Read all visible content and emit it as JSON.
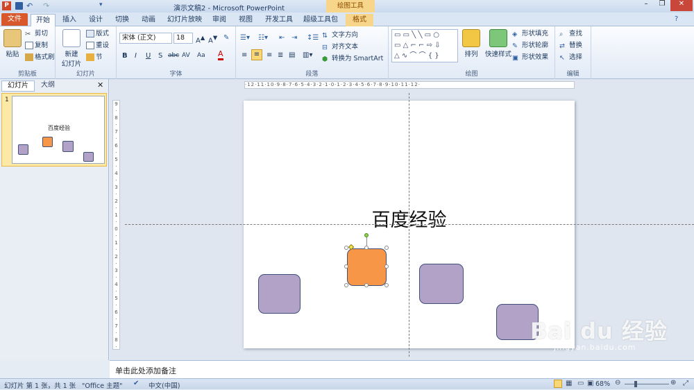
{
  "window": {
    "title": "演示文稿2 - Microsoft PowerPoint",
    "context_tab": "绘图工具"
  },
  "tabs": [
    {
      "label": "文件"
    },
    {
      "label": "开始"
    },
    {
      "label": "插入"
    },
    {
      "label": "设计"
    },
    {
      "label": "切换"
    },
    {
      "label": "动画"
    },
    {
      "label": "幻灯片放映"
    },
    {
      "label": "审阅"
    },
    {
      "label": "视图"
    },
    {
      "label": "开发工具"
    },
    {
      "label": "超级工具包"
    },
    {
      "label": "格式"
    }
  ],
  "ribbon": {
    "clipboard": {
      "paste": "粘贴",
      "cut": "剪切",
      "copy": "复制",
      "format_painter": "格式刷",
      "label": "剪贴板"
    },
    "slides": {
      "new_slide": "新建",
      "new_slide2": "幻灯片",
      "layout": "版式",
      "reset": "重设",
      "section": "节",
      "label": "幻灯片"
    },
    "font": {
      "name": "宋体 (正文)",
      "size": "18",
      "label": "字体"
    },
    "paragraph": {
      "text_direction": "文字方向",
      "align_text": "对齐文本",
      "smartart": "转换为 SmartArt",
      "label": "段落"
    },
    "drawing": {
      "arrange": "排列",
      "quick_styles": "快速样式",
      "fill": "形状填充",
      "outline": "形状轮廓",
      "effects": "形状效果",
      "label": "绘图"
    },
    "editing": {
      "find": "查找",
      "replace": "替换",
      "select": "选择",
      "label": "编辑"
    }
  },
  "panel": {
    "tab_slides": "幻灯片",
    "tab_outline": "大纲",
    "slide_number": "1",
    "thumb_title": "百度经验"
  },
  "slide": {
    "title": "百度经验"
  },
  "notes": {
    "placeholder": "单击此处添加备注"
  },
  "status": {
    "slide_info": "幻灯片 第 1 张，共 1 张",
    "theme": "\"Office 主题\"",
    "language": "中文(中国)",
    "zoom": "68%"
  },
  "watermark": {
    "line1": "Bai du 经验",
    "line2": "jingyan.baidu.com"
  },
  "colors": {
    "accent_file": "#d9582b",
    "shape_purple": "#b3a2c8",
    "shape_orange": "#f79646"
  }
}
